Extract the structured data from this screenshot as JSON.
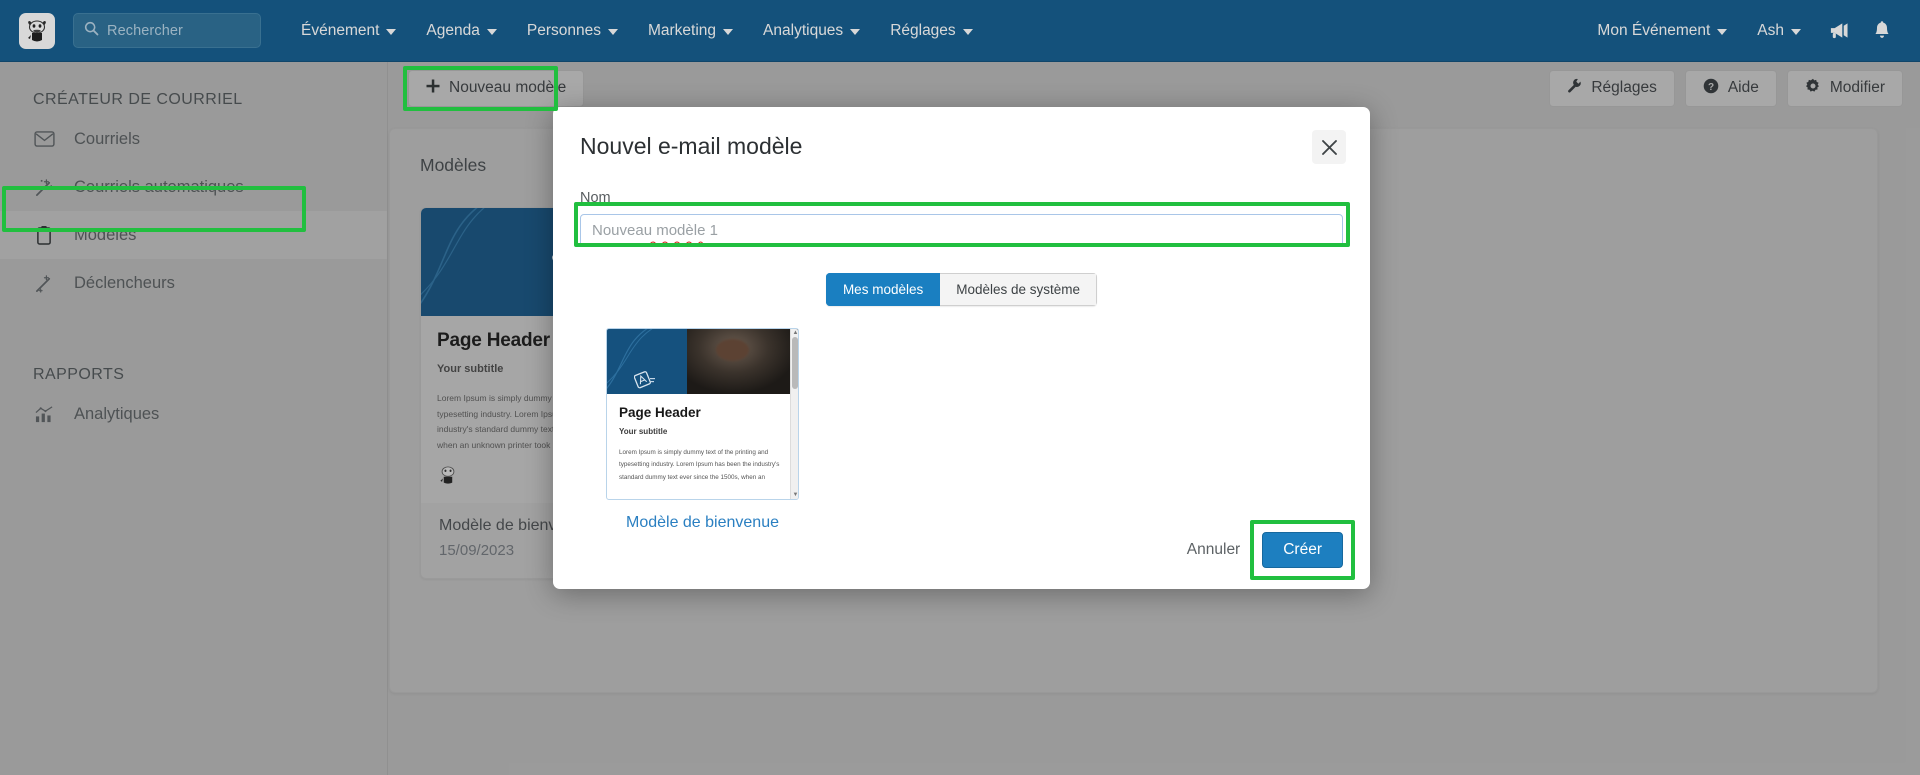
{
  "topnav": {
    "logo_icon": "cow-logo-icon",
    "search": {
      "placeholder": "Rechercher",
      "value": "",
      "icon": "search-icon"
    },
    "menus": [
      {
        "label": "Événement"
      },
      {
        "label": "Agenda"
      },
      {
        "label": "Personnes"
      },
      {
        "label": "Marketing"
      },
      {
        "label": "Analytiques"
      },
      {
        "label": "Réglages"
      }
    ],
    "right": {
      "event_selector": "Mon Événement",
      "user": "Ash",
      "announce_icon": "megaphone-icon",
      "notify_icon": "bell-icon"
    }
  },
  "sidebar": {
    "section_one_title": "CRÉATEUR DE COURRIEL",
    "items": [
      {
        "label": "Courriels",
        "icon": "envelope-icon"
      },
      {
        "label": "Courriels automatiques",
        "icon": "magic-wand-icon"
      },
      {
        "label": "Modèles",
        "icon": "clipboard-icon"
      },
      {
        "label": "Déclencheurs",
        "icon": "magic-wand-icon"
      }
    ],
    "section_two_title": "RAPPORTS",
    "reports": [
      {
        "label": "Analytiques",
        "icon": "bar-chart-icon"
      }
    ]
  },
  "toolbar": {
    "new_template": "Nouveau modèle",
    "settings": "Réglages",
    "help": "Aide",
    "edit": "Modifier",
    "settings_icon": "wrench-icon",
    "help_icon": "question-circle-icon",
    "edit_icon": "gear-icon",
    "plus_icon": "plus-icon"
  },
  "content": {
    "title": "Modèles",
    "card": {
      "preview_heading": "Page Header",
      "preview_subtitle": "Your subtitle",
      "preview_text": "Lorem Ipsum is simply dummy text of the printing and typesetting industry. Lorem Ipsum has been the industry's standard dummy text ever since the 1500s, when an unknown printer took a galley of type.",
      "name": "Modèle de bienvenue",
      "date": "15/09/2023"
    }
  },
  "modal": {
    "title": "Nouvel e-mail modèle",
    "close_icon": "close-icon",
    "name_label": "Nom",
    "name_placeholder": "Nouveau modèle 1",
    "name_value": "",
    "tabs": [
      {
        "label": "Mes modèles",
        "selected": true
      },
      {
        "label": "Modèles de système",
        "selected": false
      }
    ],
    "template": {
      "heading": "Page Header",
      "subtitle": "Your subtitle",
      "body": "Lorem Ipsum is simply dummy text of the printing and typesetting industry. Lorem Ipsum has been the industry's standard dummy text ever since the 1500s, when an",
      "label": "Modèle de bienvenue"
    },
    "cancel": "Annuler",
    "create": "Créer"
  },
  "colors": {
    "navbar": "#105b8e",
    "accent_blue": "#1d7fc0",
    "highlight_green": "#21bf3f",
    "page_bg": "#b4b4b4",
    "link_blue": "#2a7fc1"
  }
}
